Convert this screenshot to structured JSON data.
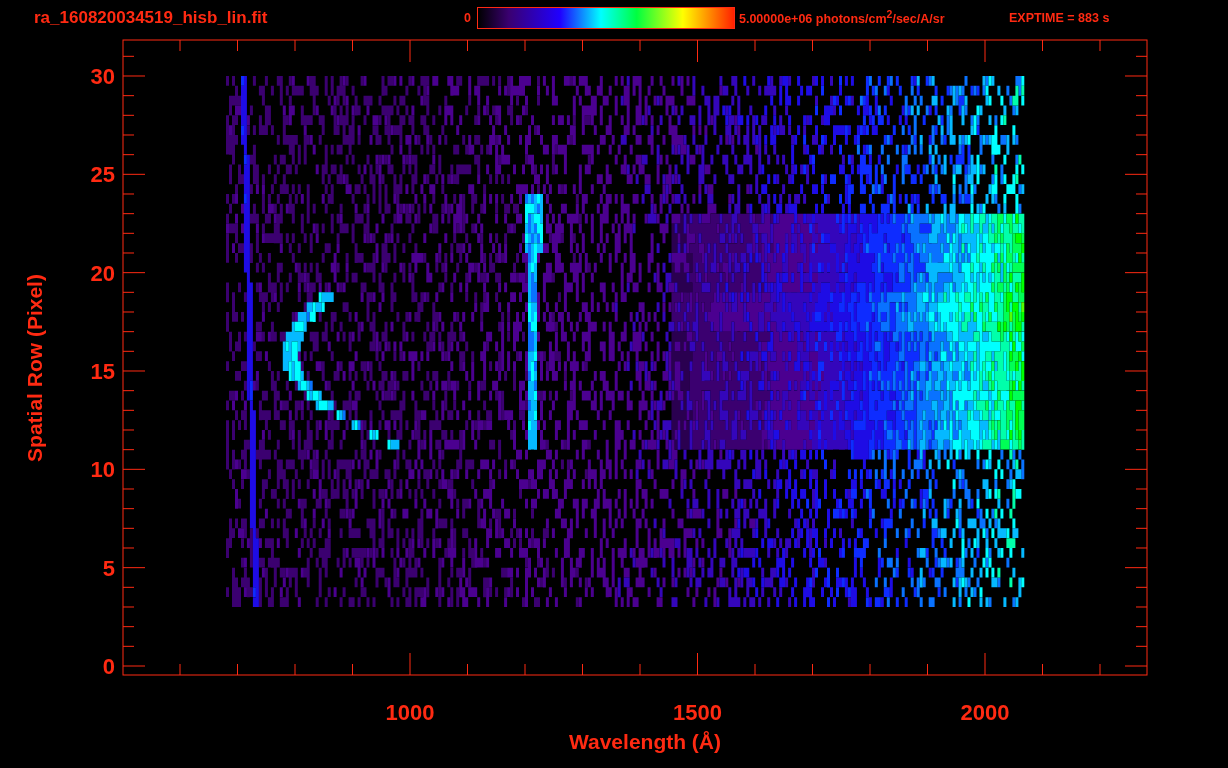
{
  "title": "ra_160820034519_hisb_lin.fit",
  "colorbar": {
    "min_label": "0",
    "max_label": "5.00000e+06 photons/cm$^{2}$/sec/A/sr"
  },
  "exposure": "EXPTIME = 883 s",
  "plot": {
    "y_axis": {
      "label": "Spatial Row (Pixel)",
      "ticks": [
        "30",
        "25",
        "20",
        "15",
        "10",
        "5",
        "0"
      ]
    },
    "x_axis": {
      "label": "Wavelength (Å)",
      "ticks": [
        "1000",
        "1500",
        "2000"
      ]
    }
  }
}
